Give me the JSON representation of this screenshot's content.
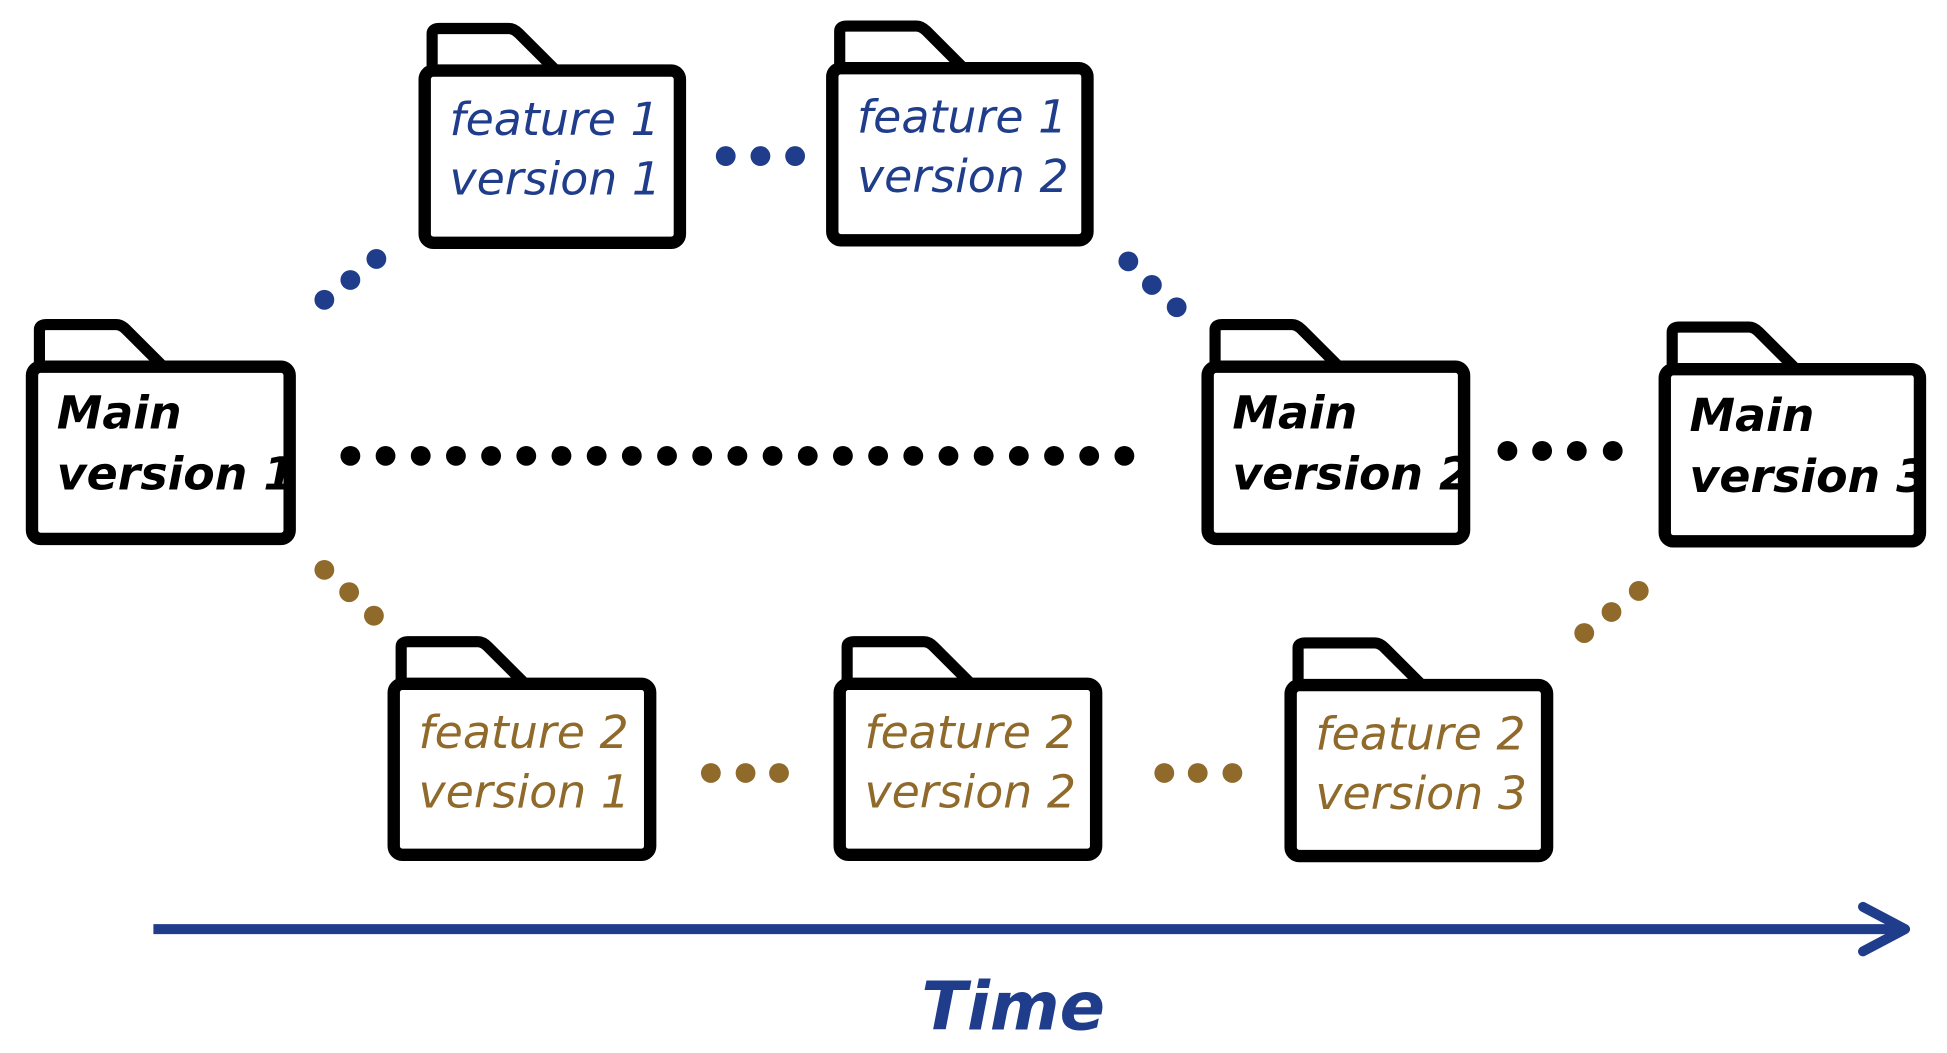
{
  "colors": {
    "main": "#000000",
    "feature1": "#1f3d8a",
    "feature2": "#8f6a2a",
    "time_axis": "#1f3d8a"
  },
  "folders": [
    {
      "id": "main-v1",
      "line1": "Main",
      "line2": "version 1",
      "branch": "main"
    },
    {
      "id": "main-v2",
      "line1": "Main",
      "line2": "version 2",
      "branch": "main"
    },
    {
      "id": "main-v3",
      "line1": "Main",
      "line2": "version 3",
      "branch": "main"
    },
    {
      "id": "feature1-v1",
      "line1": "feature 1",
      "line2": "version 1",
      "branch": "feature1"
    },
    {
      "id": "feature1-v2",
      "line1": "feature 1",
      "line2": "version 2",
      "branch": "feature1"
    },
    {
      "id": "feature2-v1",
      "line1": "feature 2",
      "line2": "version 1",
      "branch": "feature2"
    },
    {
      "id": "feature2-v2",
      "line1": "feature 2",
      "line2": "version 2",
      "branch": "feature2"
    },
    {
      "id": "feature2-v3",
      "line1": "feature 2",
      "line2": "version 3",
      "branch": "feature2"
    }
  ],
  "axis": {
    "label": "Time",
    "icon": "arrow-right-icon"
  }
}
